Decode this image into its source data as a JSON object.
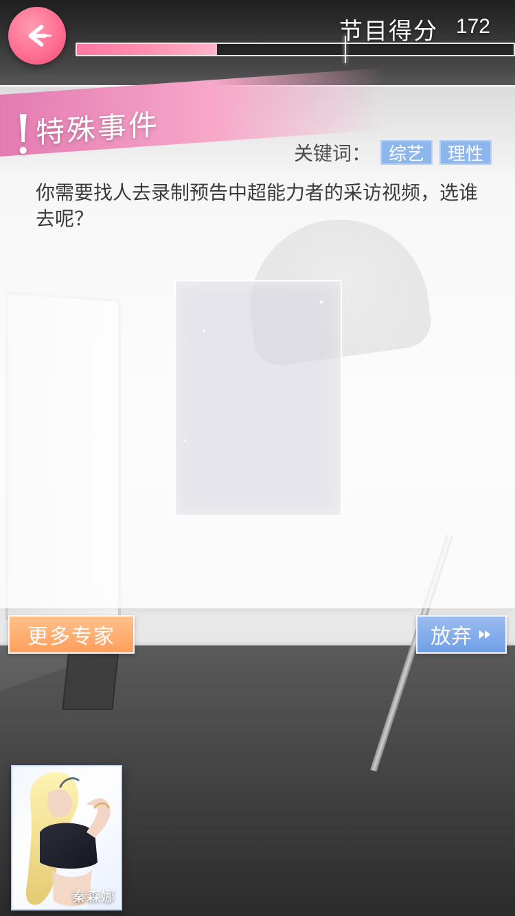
{
  "header": {
    "back_icon": "back-arrow-icon",
    "score_label": "节目得分",
    "score_value": "172",
    "progress_fill_fraction": 0.32,
    "progress_marker_fraction": 0.61,
    "accent": "#ff6f93"
  },
  "event": {
    "title": "特殊事件",
    "keywords_label": "关键词：",
    "tags": [
      "综艺",
      "理性"
    ],
    "question": "你需要找人去录制预告中超能力者的采访视频，选谁去呢？"
  },
  "actions": {
    "more_experts_label": "更多专家",
    "give_up_label": "放弃",
    "give_up_icon": "fast-forward-icon"
  },
  "character": {
    "name": "秦森娜"
  }
}
